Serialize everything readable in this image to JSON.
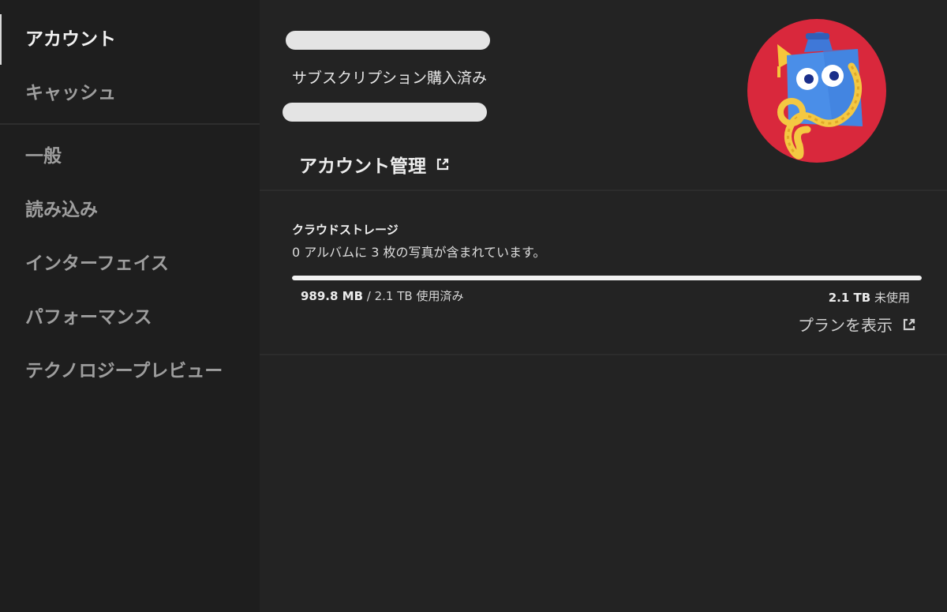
{
  "sidebar": {
    "top_items": [
      {
        "label": "アカウント",
        "active": true
      },
      {
        "label": "キャッシュ",
        "active": false
      }
    ],
    "bottom_items": [
      {
        "label": "一般"
      },
      {
        "label": "読み込み"
      },
      {
        "label": "インターフェイス"
      },
      {
        "label": "パフォーマンス"
      },
      {
        "label": "テクノロジープレビュー"
      }
    ]
  },
  "account": {
    "subscription_status": "サブスクリプション購入済み",
    "manage_label": "アカウント管理",
    "avatar_icon": "avatar-character-icon"
  },
  "storage": {
    "title": "クラウドストレージ",
    "description": "0 アルバムに 3 枚の写真が含まれています。",
    "used_amount": "989.8 MB",
    "used_suffix": " / 2.1 TB 使用済み",
    "free_amount": "2.1 TB",
    "free_suffix": " 未使用",
    "usage_fraction": 1.0,
    "plan_label": "プランを表示"
  },
  "colors": {
    "background": "#1e1e1e",
    "panel": "#232323",
    "avatar_circle": "#d9283c",
    "avatar_face": "#4a8ee8"
  }
}
